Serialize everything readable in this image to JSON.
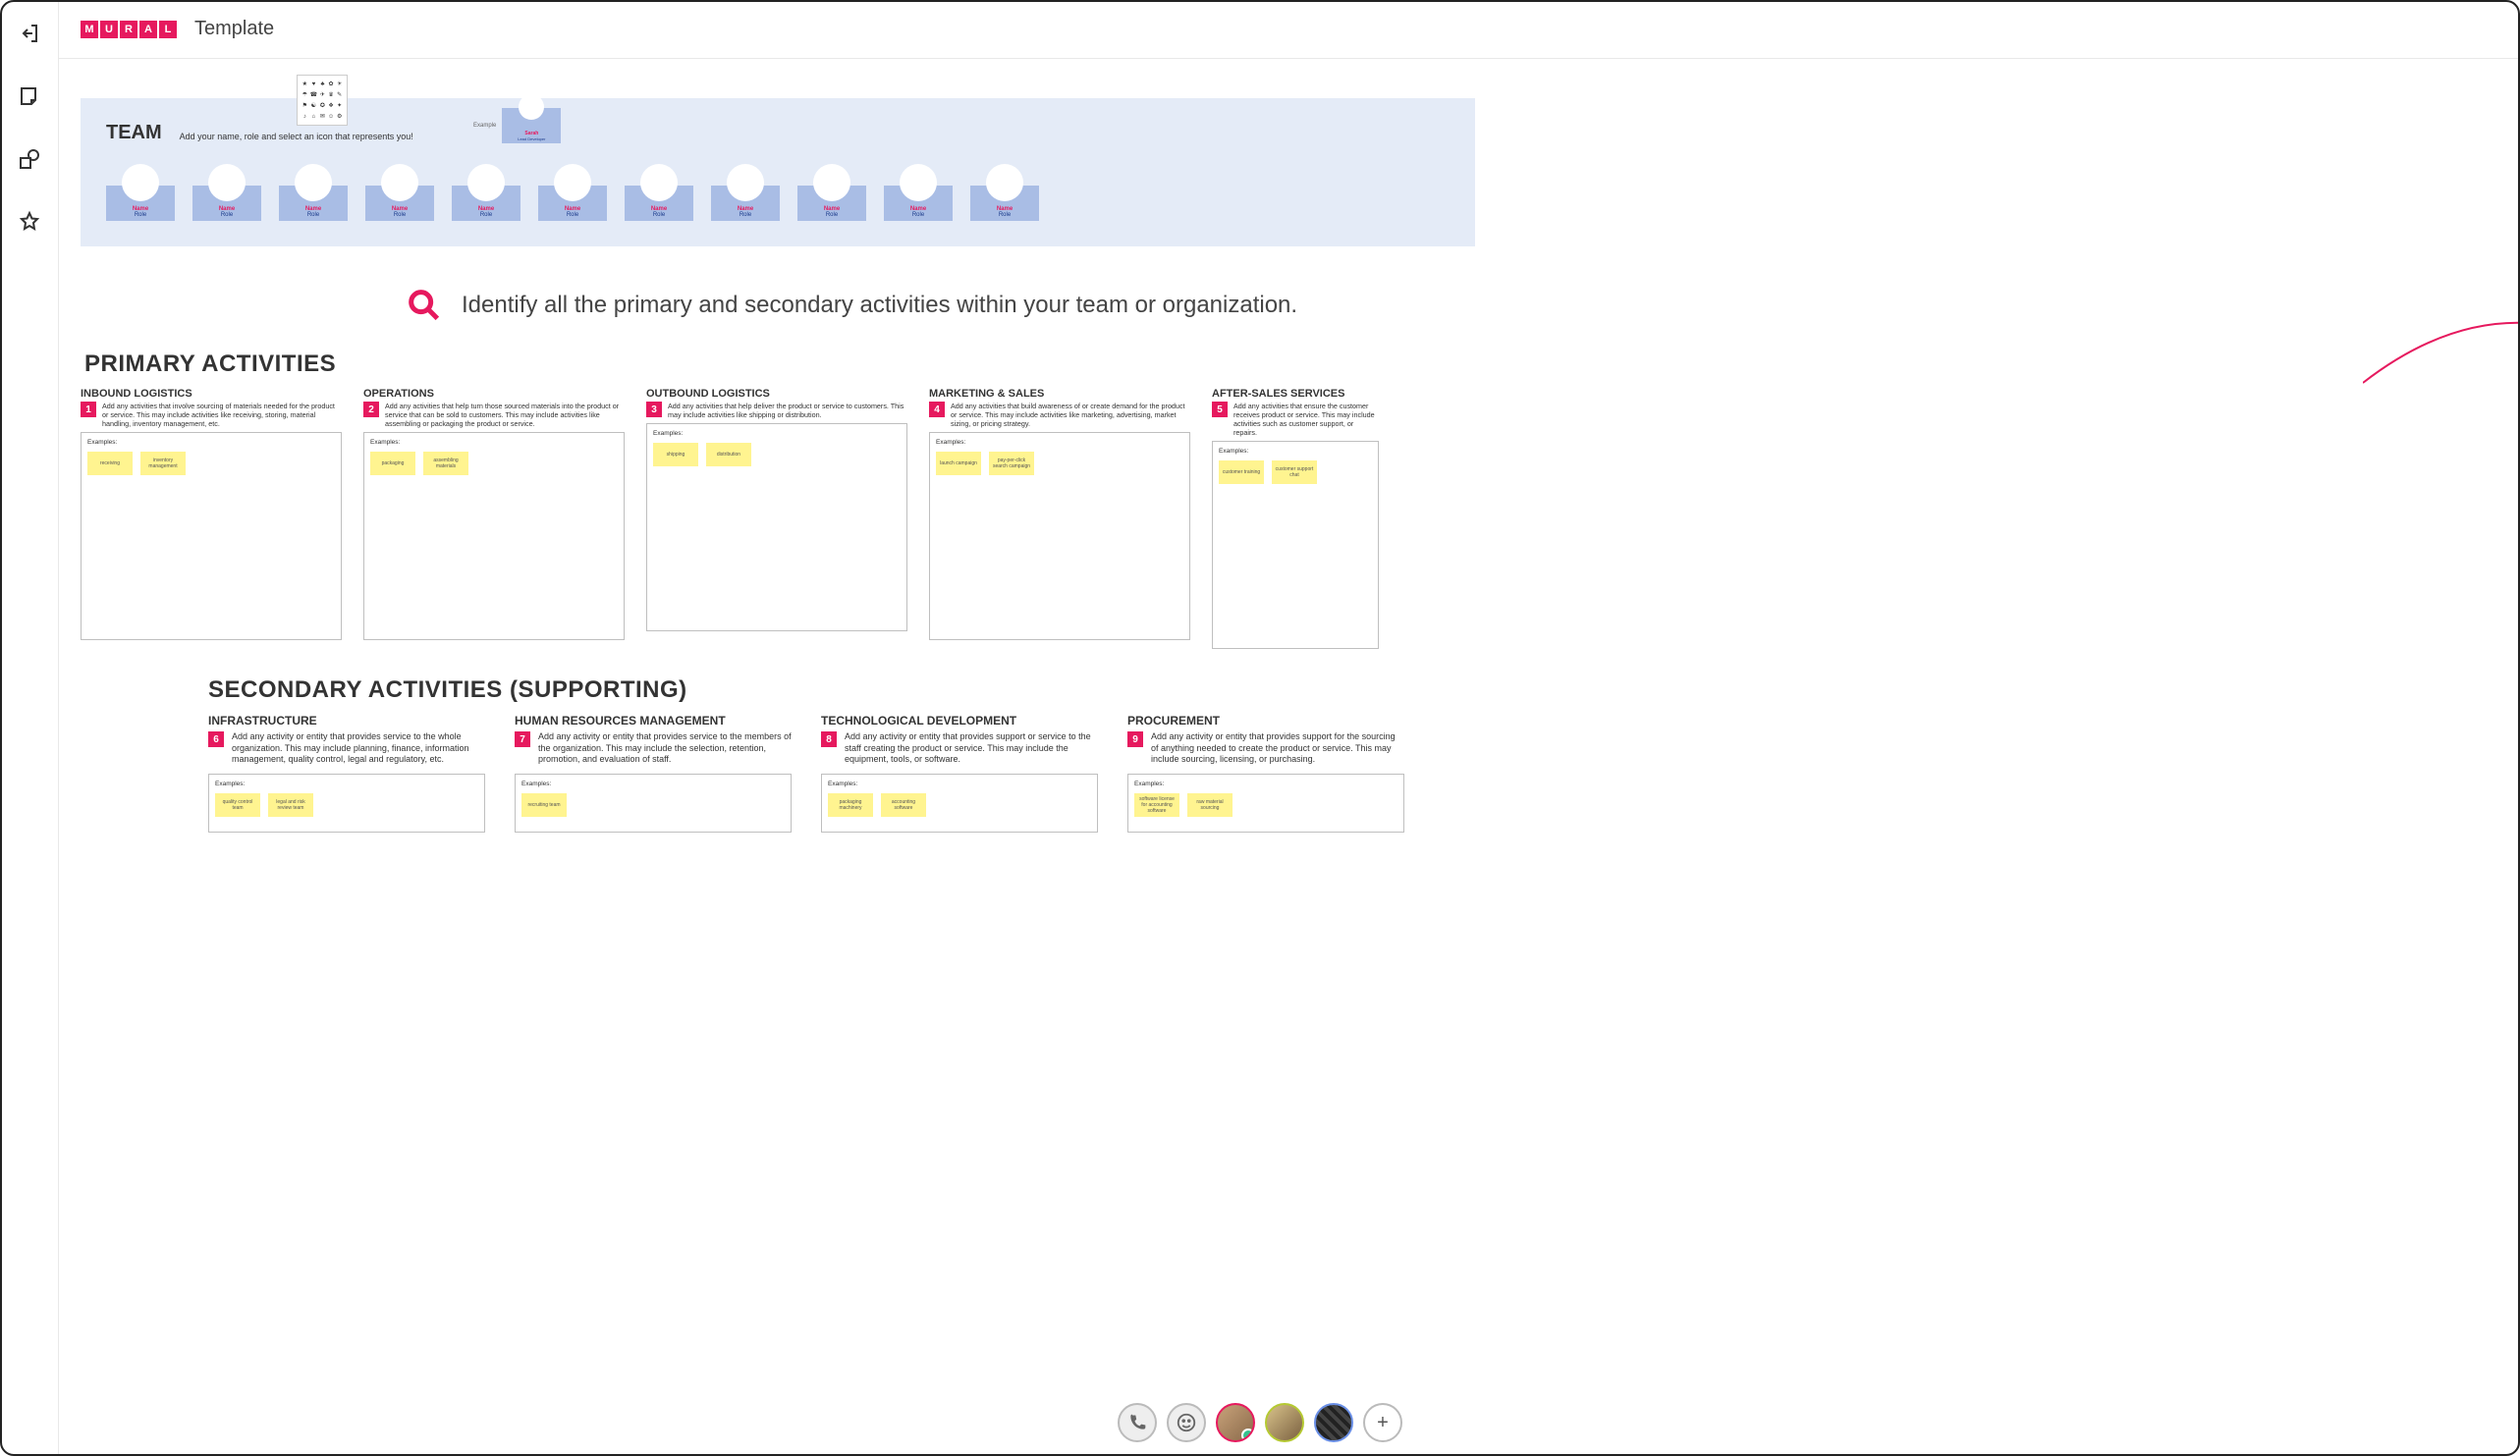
{
  "app": {
    "title": "Template",
    "logo_letters": [
      "M",
      "U",
      "R",
      "A",
      "L"
    ]
  },
  "team": {
    "title": "TEAM",
    "subtitle": "Add your name, role and select an icon that represents you!",
    "example_label": "Example",
    "example_name": "Sarah",
    "example_role": "Lead Developer",
    "slot_name": "Name",
    "slot_role": "Role",
    "slot_count": 11
  },
  "identify": {
    "text": "Identify all the primary and secondary activities within your team or organization."
  },
  "sections": {
    "primary_title": "PRIMARY ACTIVITIES",
    "secondary_title": "SECONDARY ACTIVITIES (SUPPORTING)",
    "examples_label": "Examples:"
  },
  "primary": [
    {
      "num": "1",
      "title": "INBOUND LOGISTICS",
      "desc": "Add any activities that involve sourcing of materials needed for the product or service. This may include activities like receiving, storing, material handling, inventory management, etc.",
      "examples": [
        "receiving",
        "inventory management"
      ]
    },
    {
      "num": "2",
      "title": "OPERATIONS",
      "desc": "Add any activities that help turn those sourced materials into the product or service that can be sold to customers. This may include activities like assembling or packaging the product or service.",
      "examples": [
        "packaging",
        "assembling materials"
      ]
    },
    {
      "num": "3",
      "title": "OUTBOUND LOGISTICS",
      "desc": "Add any activities that help deliver the product or service to customers. This may include activities like shipping or distribution.",
      "examples": [
        "shipping",
        "distribution"
      ]
    },
    {
      "num": "4",
      "title": "MARKETING & SALES",
      "desc": "Add any activities that build awareness of or create demand for the product or service. This may include activities like marketing, advertising, market sizing, or pricing strategy.",
      "examples": [
        "launch campaign",
        "pay-per-click search campaign"
      ]
    },
    {
      "num": "5",
      "title": "AFTER-SALES SERVICES",
      "desc": "Add any activities that ensure the customer receives product or service. This may include activities such as customer support, or repairs.",
      "examples": [
        "customer training",
        "customer support chat"
      ]
    }
  ],
  "secondary": [
    {
      "num": "6",
      "title": "INFRASTRUCTURE",
      "desc": "Add any activity or entity that provides service to the whole organization. This may include planning, finance, information management, quality control, legal and regulatory, etc.",
      "examples": [
        "quality control team",
        "legal and risk review team"
      ]
    },
    {
      "num": "7",
      "title": "HUMAN RESOURCES MANAGEMENT",
      "desc": "Add any activity or entity that provides service to the members of the organization. This may include the selection, retention, promotion, and evaluation of staff.",
      "examples": [
        "recruiting team",
        ""
      ]
    },
    {
      "num": "8",
      "title": "TECHNOLOGICAL DEVELOPMENT",
      "desc": "Add any activity or entity that provides support or service to the staff creating the product or service. This may include the equipment, tools, or software.",
      "examples": [
        "packaging machinery",
        "accounting software"
      ]
    },
    {
      "num": "9",
      "title": "PROCUREMENT",
      "desc": "Add any activity or entity that provides support for the sourcing of anything needed to create the product or service. This may include sourcing, licensing, or purchasing.",
      "examples": [
        "software license for accounting software",
        "raw material sourcing"
      ]
    }
  ],
  "dock": {
    "phone": "phone",
    "emoji": "emoji",
    "plus": "+"
  }
}
